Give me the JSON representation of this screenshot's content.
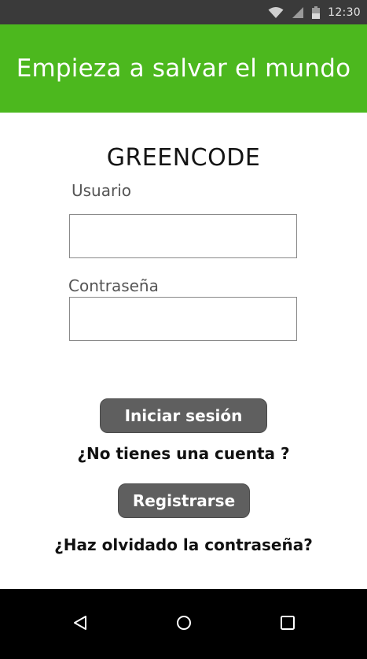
{
  "status_bar": {
    "time": "12:30",
    "icons": [
      "wifi-icon",
      "signal-icon",
      "battery-icon"
    ]
  },
  "app_bar": {
    "title": "Empieza a salvar el mundo",
    "color": "#4cb81e"
  },
  "login": {
    "brand": "GREENCODE",
    "username_label": "Usuario",
    "username_value": "",
    "password_label": "Contraseña",
    "password_value": "",
    "login_button": "Iniciar sesión",
    "no_account_text": "¿No tienes una cuenta ?",
    "register_button": "Registrarse",
    "forgot_password_text": "¿Haz olvidado la contraseña?",
    "button_color": "#5f5f5f"
  },
  "nav_bar": {
    "icons": [
      "back-icon",
      "home-icon",
      "recents-icon"
    ]
  }
}
